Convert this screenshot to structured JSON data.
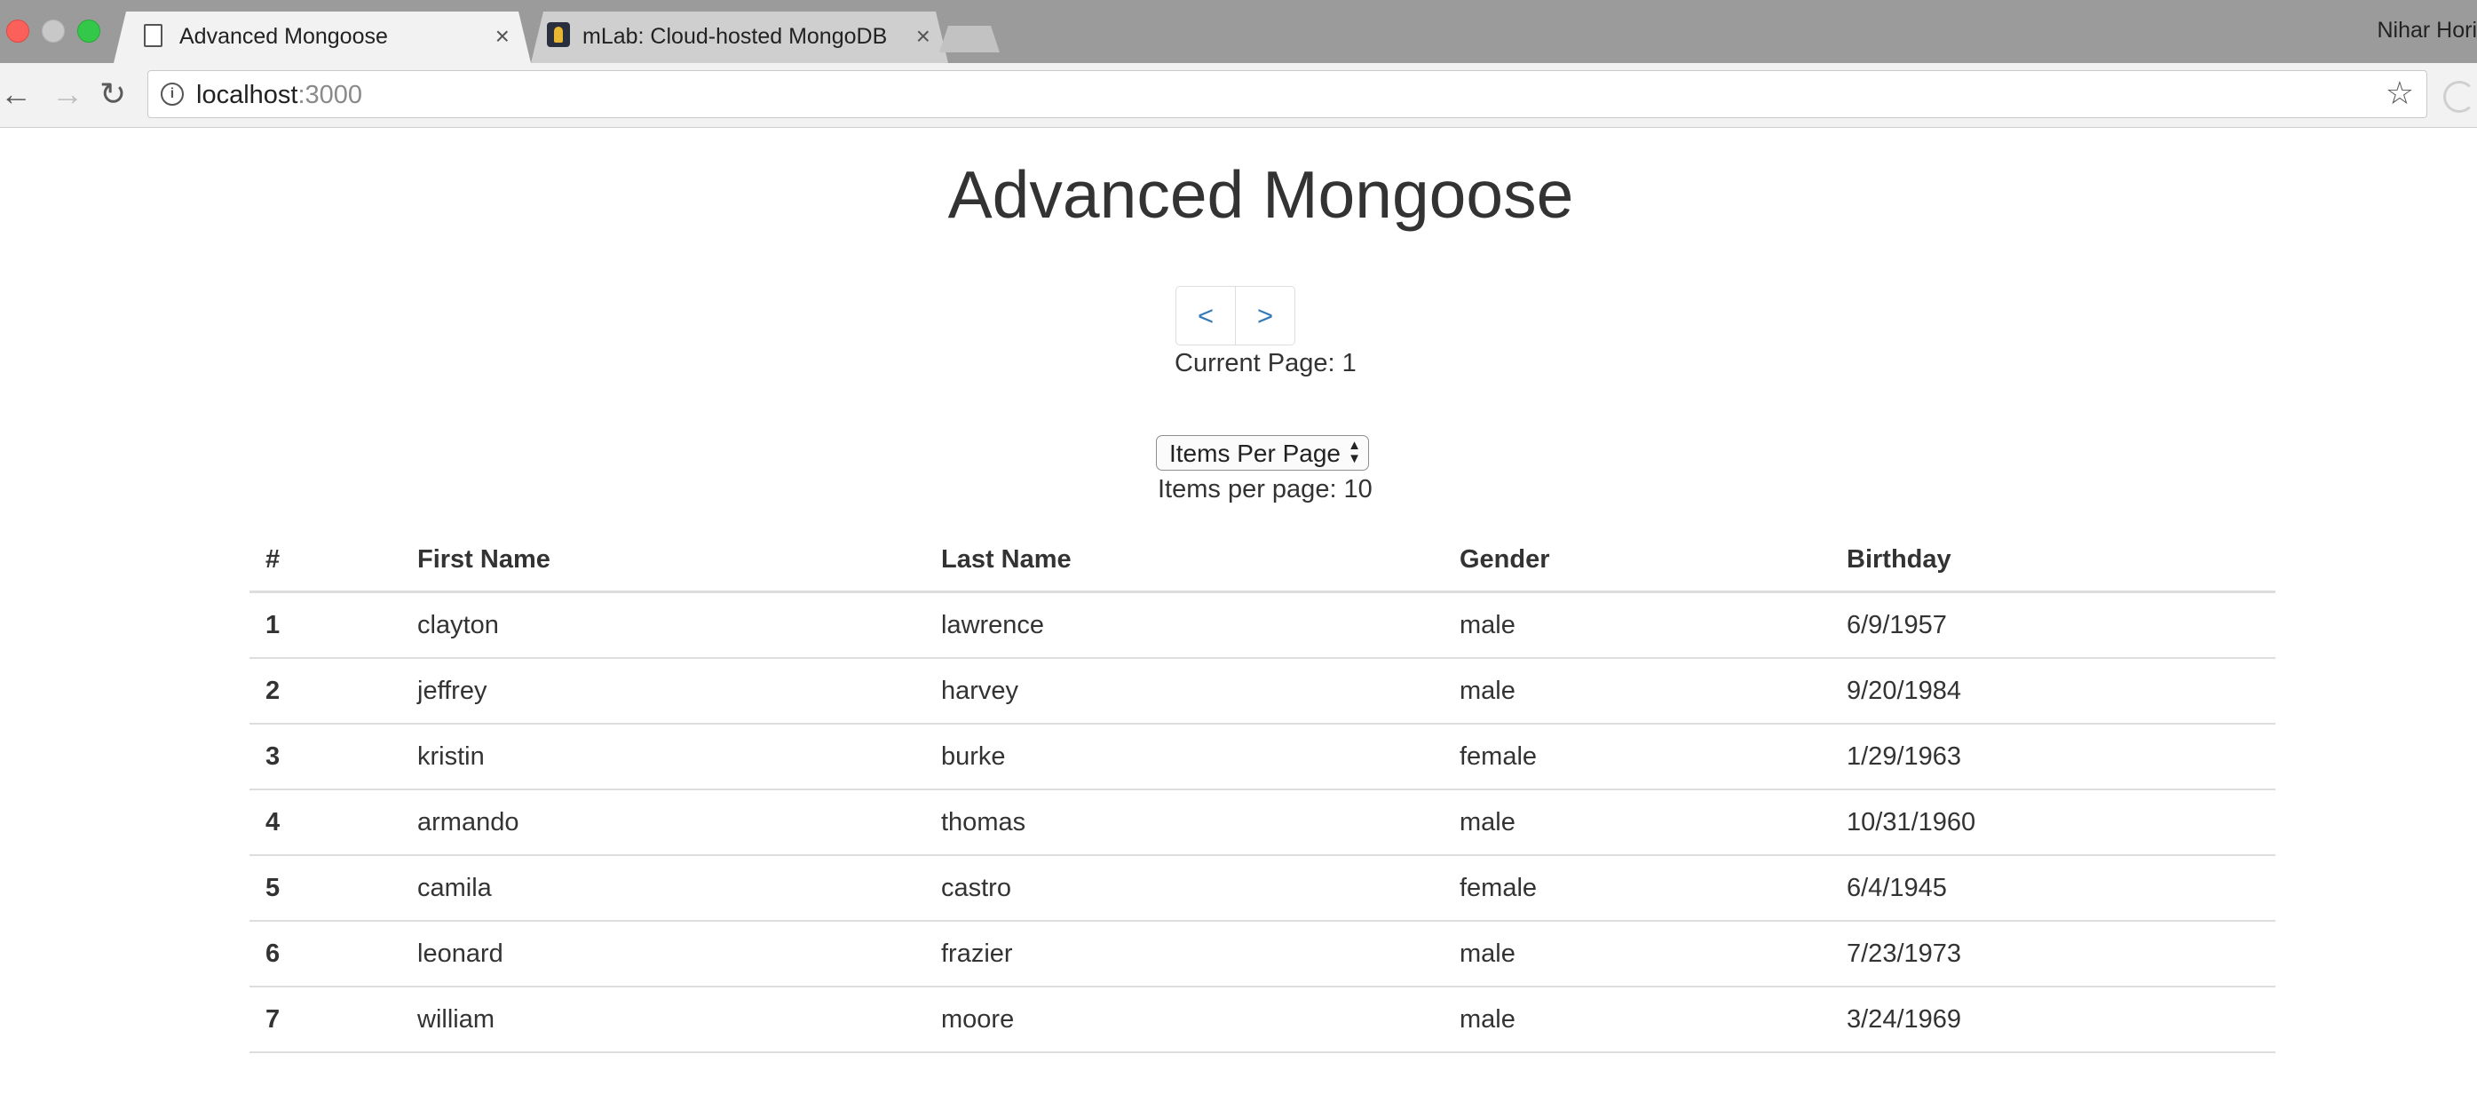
{
  "browser": {
    "tabs": [
      {
        "title": "Advanced Mongoose",
        "close": "×"
      },
      {
        "title": "mLab: Cloud-hosted MongoDB",
        "close": "×"
      }
    ],
    "profile_name": "Nihar Hori",
    "nav": {
      "back": "←",
      "forward": "→",
      "reload": "↻"
    },
    "url_host": "localhost",
    "url_port": ":3000",
    "info_icon": "i",
    "star": "☆"
  },
  "page": {
    "title": "Advanced Mongoose",
    "pager": {
      "prev": "<",
      "next": ">"
    },
    "current_page": "Current Page: 1",
    "items_select": {
      "label": "Items Per Page",
      "arrows": "▲▼"
    },
    "items_per_page": "Items per page: 10"
  },
  "table": {
    "headers": [
      "#",
      "First Name",
      "Last Name",
      "Gender",
      "Birthday"
    ],
    "rows": [
      [
        "1",
        "clayton",
        "lawrence",
        "male",
        "6/9/1957"
      ],
      [
        "2",
        "jeffrey",
        "harvey",
        "male",
        "9/20/1984"
      ],
      [
        "3",
        "kristin",
        "burke",
        "female",
        "1/29/1963"
      ],
      [
        "4",
        "armando",
        "thomas",
        "male",
        "10/31/1960"
      ],
      [
        "5",
        "camila",
        "castro",
        "female",
        "6/4/1945"
      ],
      [
        "6",
        "leonard",
        "frazier",
        "male",
        "7/23/1973"
      ],
      [
        "7",
        "william",
        "moore",
        "male",
        "3/24/1969"
      ]
    ]
  }
}
